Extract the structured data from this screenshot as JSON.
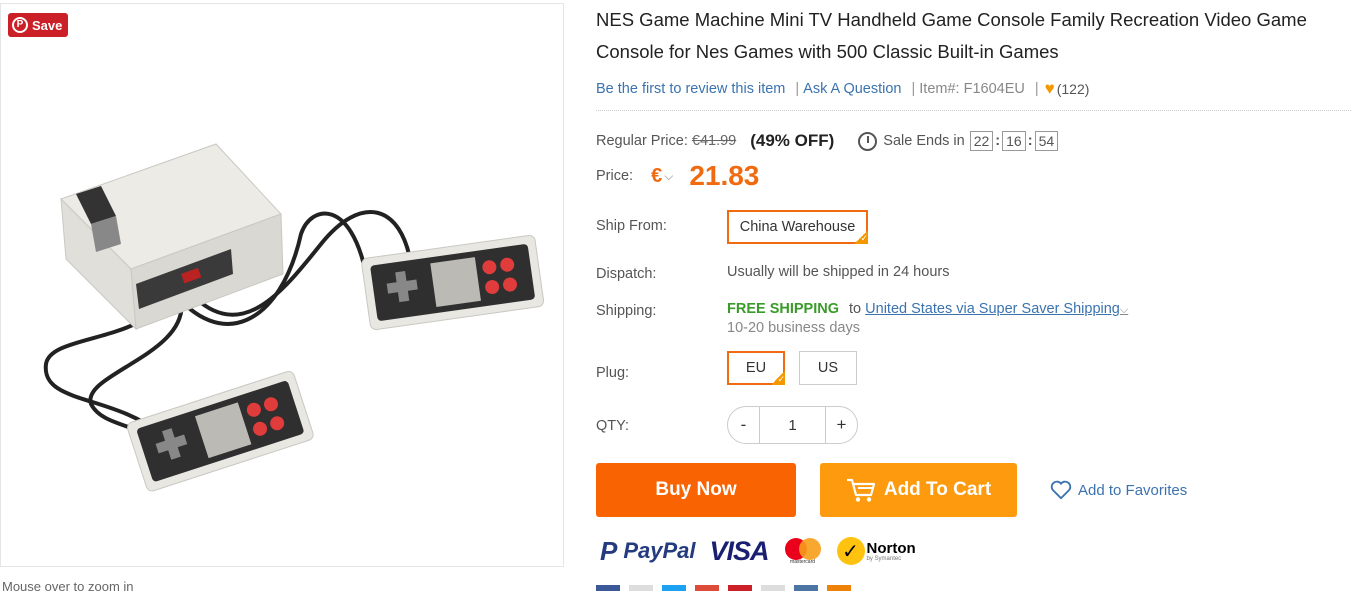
{
  "pinterest": {
    "save_label": "Save"
  },
  "gallery": {
    "zoom_hint": "Mouse over to zoom in"
  },
  "product": {
    "title": "NES Game Machine Mini TV Handheld Game Console Family Recreation Video Game Console for Nes Games with 500 Classic Built-in Games",
    "review_link": "Be the first to review this item",
    "ask_link": "Ask A Question",
    "item_no": "Item#: F1604EU",
    "favorites_count": "(122)"
  },
  "pricing": {
    "regular_label": "Regular Price:",
    "regular_price": "€41.99",
    "discount": "(49% OFF)",
    "sale_ends_label": "Sale Ends in",
    "countdown": {
      "hours": "22",
      "minutes": "16",
      "seconds": "54"
    },
    "price_label": "Price:",
    "currency": "€",
    "price": "21.83"
  },
  "ship_from": {
    "label": "Ship From:",
    "selected": "China Warehouse"
  },
  "dispatch": {
    "label": "Dispatch:",
    "value": "Usually will be shipped in 24 hours"
  },
  "shipping": {
    "label": "Shipping:",
    "free": "FREE SHIPPING",
    "to": "to",
    "destination": "United States via Super Saver Shipping",
    "days": "10-20 business days"
  },
  "plug": {
    "label": "Plug:",
    "options": [
      "EU",
      "US"
    ],
    "selected": "EU"
  },
  "qty": {
    "label": "QTY:",
    "minus": "-",
    "value": "1",
    "plus": "+"
  },
  "actions": {
    "buy_now": "Buy Now",
    "add_to_cart": "Add To Cart",
    "add_to_favorites": "Add to Favorites"
  },
  "payments": {
    "paypal": "PayPal",
    "visa": "VISA",
    "mastercard": "mastercard",
    "norton": "Norton",
    "norton_sub": "by Symantec"
  },
  "colors": {
    "accent_orange": "#f96302",
    "cart_orange": "#fd9a0d",
    "price_orange": "#f06a0f",
    "link_blue": "#3b73af",
    "free_green": "#3a9b2a",
    "pinterest_red": "#cb2027"
  }
}
